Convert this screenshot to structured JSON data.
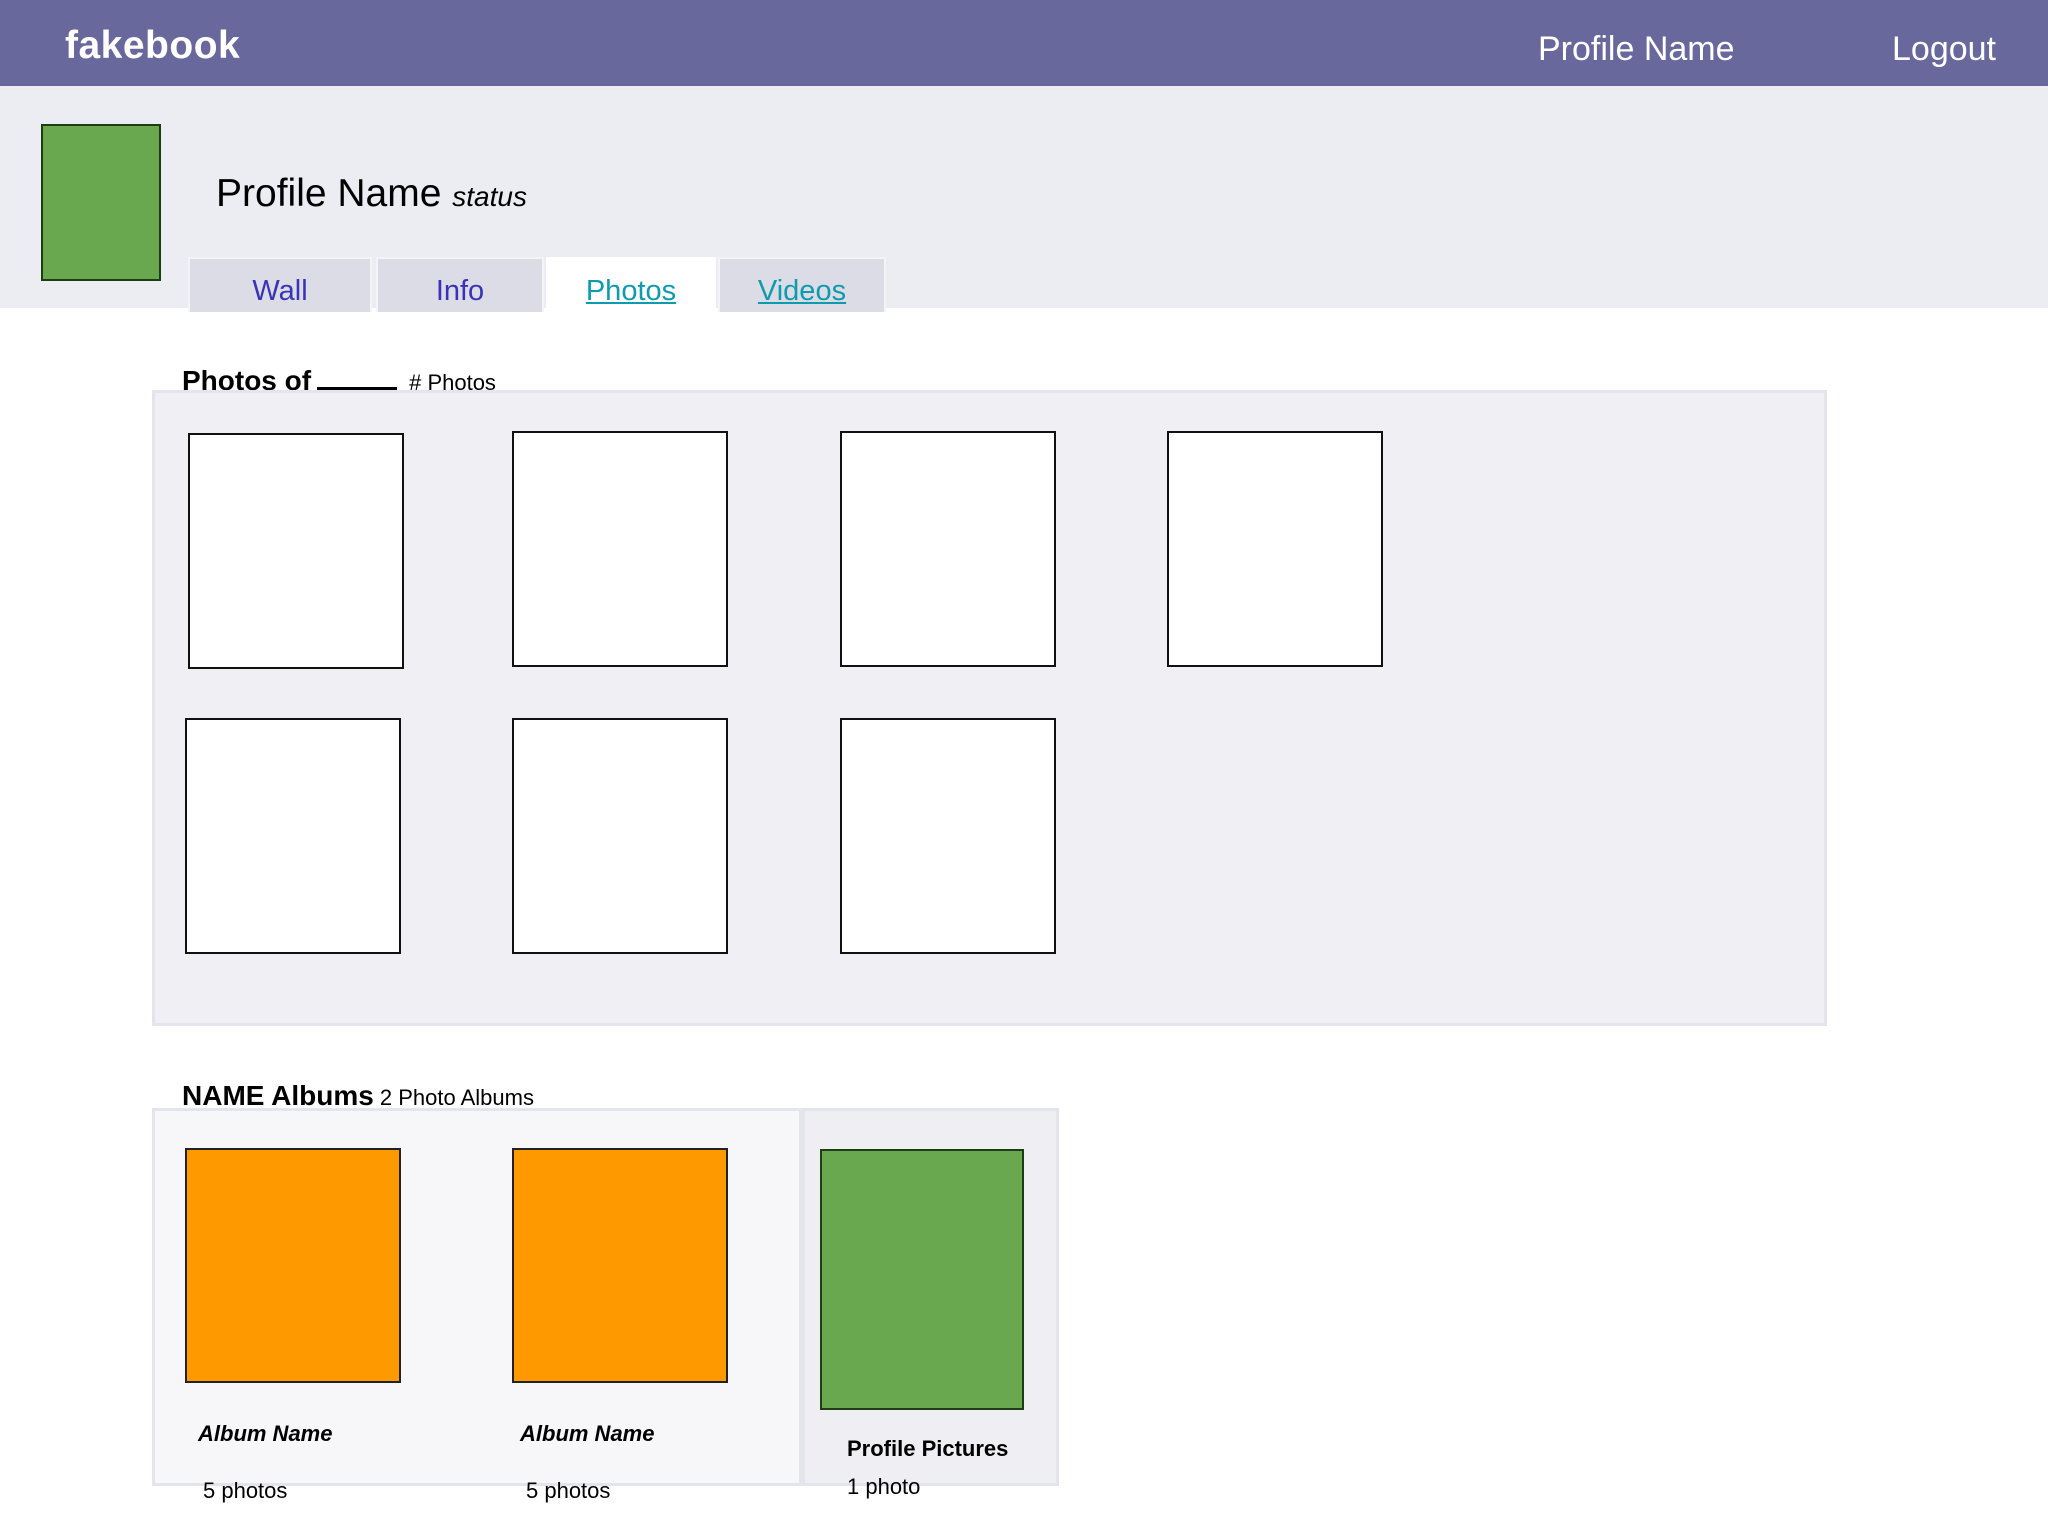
{
  "app": {
    "logo": "fakebook",
    "nav": {
      "profile_name": "Profile Name",
      "logout": "Logout"
    }
  },
  "profile": {
    "name": "Profile Name",
    "status": "status"
  },
  "tabs": [
    {
      "label": "Wall"
    },
    {
      "label": "Info"
    },
    {
      "label": "Photos",
      "active": true
    },
    {
      "label": "Videos"
    }
  ],
  "photos_section": {
    "title": "Photos of",
    "count_label": "# Photos",
    "photo_count_shown": 7
  },
  "albums_section": {
    "title": "NAME Albums",
    "count_label": "2 Photo Albums",
    "albums": [
      {
        "name": "Album Name",
        "count": "5 photos"
      },
      {
        "name": "Album Name",
        "count": "5 photos"
      }
    ],
    "profile_pictures": {
      "name": "Profile Pictures",
      "count": "1 photo"
    }
  },
  "colors": {
    "topbar": "#69689c",
    "header_bg": "#ececf3",
    "avatar": "#6aa84f",
    "album_cover": "#ff9900",
    "tab_link": "#3a33b5",
    "tab_link_visited": "#0e9bad"
  }
}
